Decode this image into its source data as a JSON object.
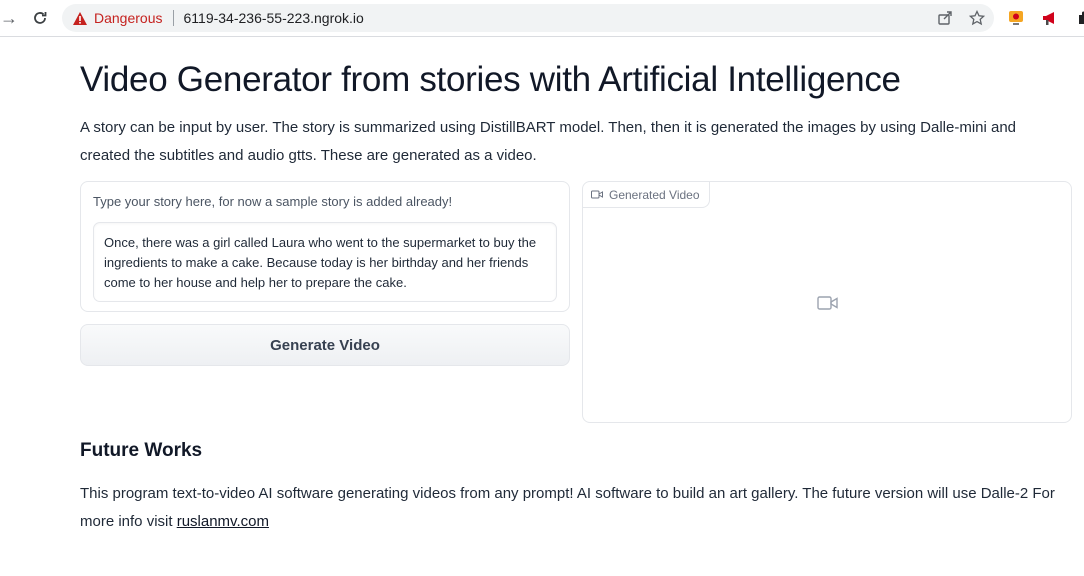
{
  "browser": {
    "security_label": "Dangerous",
    "url": "6119-34-236-55-223.ngrok.io"
  },
  "page": {
    "title": "Video Generator from stories with Artificial Intelligence",
    "description": "A story can be input by user. The story is summarized using DistillBART model. Then, then it is generated the images by using Dalle-mini and created the subtitles and audio gtts. These are generated as a video.",
    "story_label": "Type your story here, for now a sample story is added already!",
    "story_text": "Once, there was a girl called Laura who went to the supermarket to buy the ingredients to make a cake. Because today is her birthday and her friends come to her house and help her to prepare the cake.",
    "generate_button": "Generate Video",
    "video_label": "Generated Video",
    "future_title": "Future Works",
    "future_text": "This program text-to-video AI software generating videos from any prompt! AI software to build an art gallery. The future version will use Dalle-2 For more info visit ",
    "future_link": "ruslanmv.com"
  },
  "colors": {
    "danger": "#c5221f",
    "omnibox_bg": "#f1f3f4",
    "panel_border": "#e5e7eb"
  },
  "icons": [
    "forward-arrow-icon",
    "reload-icon",
    "warning-triangle-icon",
    "share-icon",
    "star-icon",
    "extension-record-icon",
    "extension-megaphone-icon",
    "puzzle-icon",
    "video-camera-icon"
  ]
}
